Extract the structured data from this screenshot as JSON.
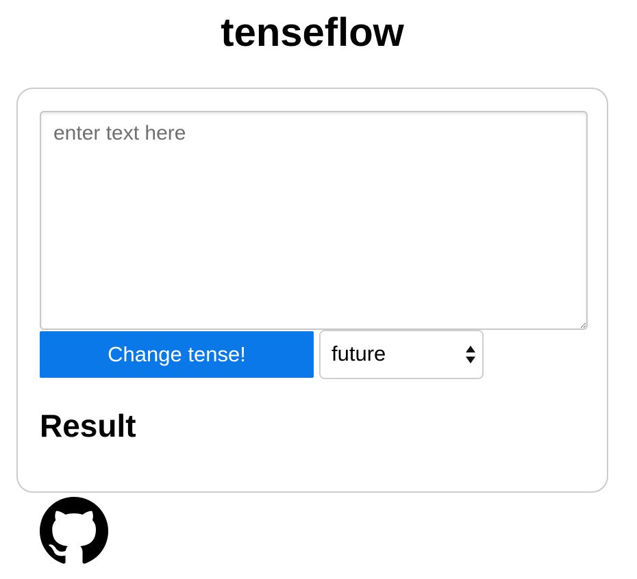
{
  "app": {
    "title": "tenseflow"
  },
  "form": {
    "text_input": {
      "placeholder": "enter text here",
      "value": ""
    },
    "submit_label": "Change tense!",
    "tense_select": {
      "selected": "future",
      "icon": "chevron-up-down-icon"
    }
  },
  "result": {
    "heading": "Result"
  },
  "footer": {
    "github_icon": "github-icon"
  },
  "colors": {
    "primary_button": "#0a78e8",
    "card_border": "#cccccc",
    "placeholder_text": "#6f6f6f"
  }
}
